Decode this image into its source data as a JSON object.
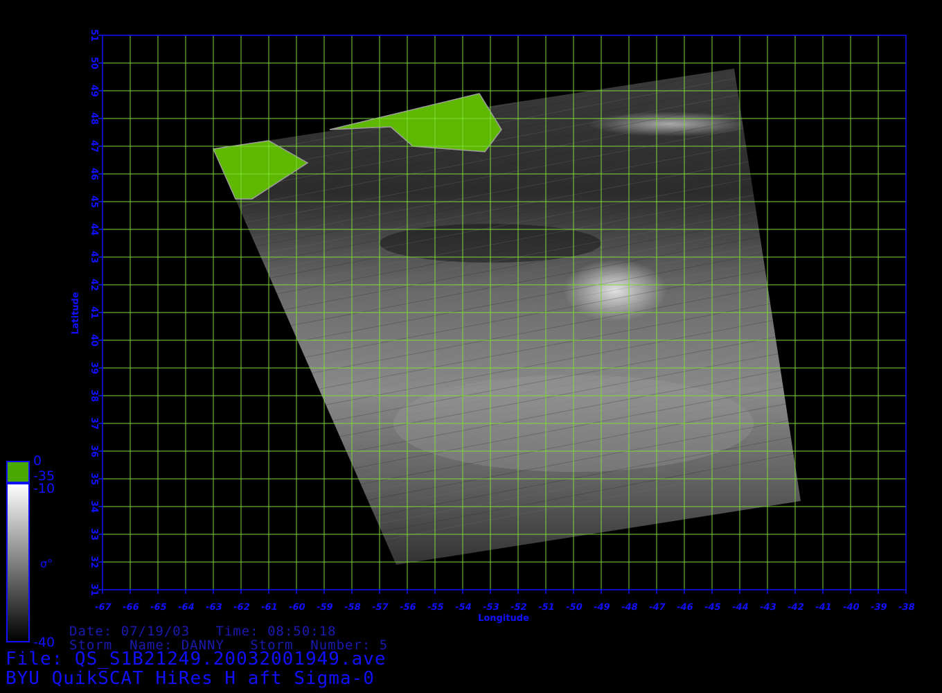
{
  "map": {
    "xlabel": "Longitude",
    "ylabel": "Latitude",
    "lon_range": [
      -67,
      -38
    ],
    "lat_range": [
      31,
      51
    ],
    "lon_ticks": [
      "-67",
      "-66",
      "-65",
      "-64",
      "-63",
      "-62",
      "-61",
      "-60",
      "-59",
      "-58",
      "-57",
      "-56",
      "-55",
      "-54",
      "-53",
      "-52",
      "-51",
      "-50",
      "-49",
      "-48",
      "-47",
      "-46",
      "-45",
      "-44",
      "-43",
      "-42",
      "-41",
      "-40",
      "-39",
      "-38"
    ],
    "lat_ticks": [
      "31",
      "32",
      "33",
      "34",
      "35",
      "36",
      "37",
      "38",
      "39",
      "40",
      "41",
      "42",
      "43",
      "44",
      "45",
      "46",
      "47",
      "48",
      "49",
      "50",
      "51"
    ],
    "grid": true,
    "grid_color": "#7ddc3a",
    "axis_color": "#1010ff",
    "land_color": "#5fb800",
    "swath_corners_lonlat": [
      [
        -63,
        46.9
      ],
      [
        -44.2,
        49.8
      ],
      [
        -41.8,
        34.2
      ],
      [
        -56.4,
        31.9
      ]
    ],
    "land_patches": [
      {
        "name": "nova-scotia",
        "lonlat": [
          [
            -63,
            46.9
          ],
          [
            -61,
            47.2
          ],
          [
            -59.6,
            46.4
          ],
          [
            -61.6,
            45.1
          ],
          [
            -62.2,
            45.1
          ]
        ]
      },
      {
        "name": "newfoundland",
        "lonlat": [
          [
            -58.8,
            47.6
          ],
          [
            -53.4,
            48.9
          ],
          [
            -52.6,
            47.6
          ],
          [
            -53.2,
            46.8
          ],
          [
            -55.8,
            47.0
          ],
          [
            -56.6,
            47.7
          ]
        ]
      }
    ]
  },
  "colorbar": {
    "ticks_right": [
      "0",
      "-35",
      "-10",
      "-40"
    ],
    "symbol": "σ°",
    "green_color": "#4aa800",
    "gray_top": "#ffffff",
    "gray_bottom": "#000000"
  },
  "info": {
    "date_line": "Date: 07/19/03   Time: 08:50:18",
    "storm_line": "Storm  Name: DANNY   Storm  Number: 5",
    "file_line": "File: QS_S1B21249.20032001949.ave",
    "product_line": "BYU QuikSCAT HiRes H aft Sigma-0"
  }
}
